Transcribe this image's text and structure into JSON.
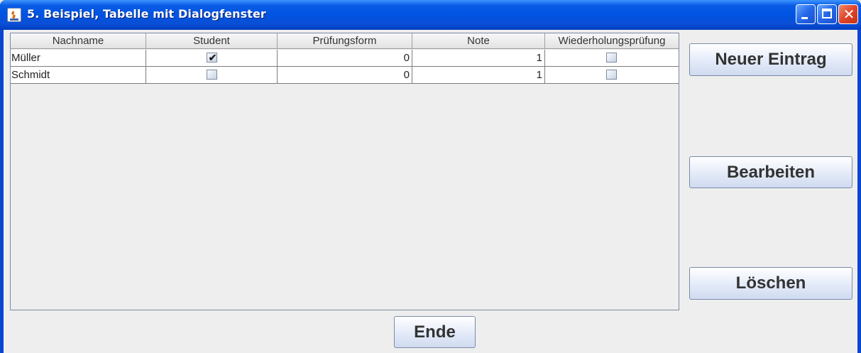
{
  "window": {
    "title": "5. Beispiel, Tabelle mit Dialogfenster",
    "icon": "java-icon",
    "controls": [
      "minimize-icon",
      "maximize-icon",
      "close-icon"
    ]
  },
  "table": {
    "columns": [
      "Nachname",
      "Student",
      "Prüfungsform",
      "Note",
      "Wiederholungsprüfung"
    ],
    "rows": [
      {
        "nachname": "Müller",
        "student": true,
        "pruefungsform": "0",
        "note": "1",
        "wiederholung": false
      },
      {
        "nachname": "Schmidt",
        "student": false,
        "pruefungsform": "0",
        "note": "1",
        "wiederholung": false
      }
    ]
  },
  "buttons": {
    "neuer_eintrag": "Neuer Eintrag",
    "bearbeiten": "Bearbeiten",
    "loeschen": "Löschen",
    "ende": "Ende"
  },
  "colors": {
    "titlebar": "#0054e3",
    "client_bg": "#eeeeee",
    "close_button": "#e0452a"
  }
}
